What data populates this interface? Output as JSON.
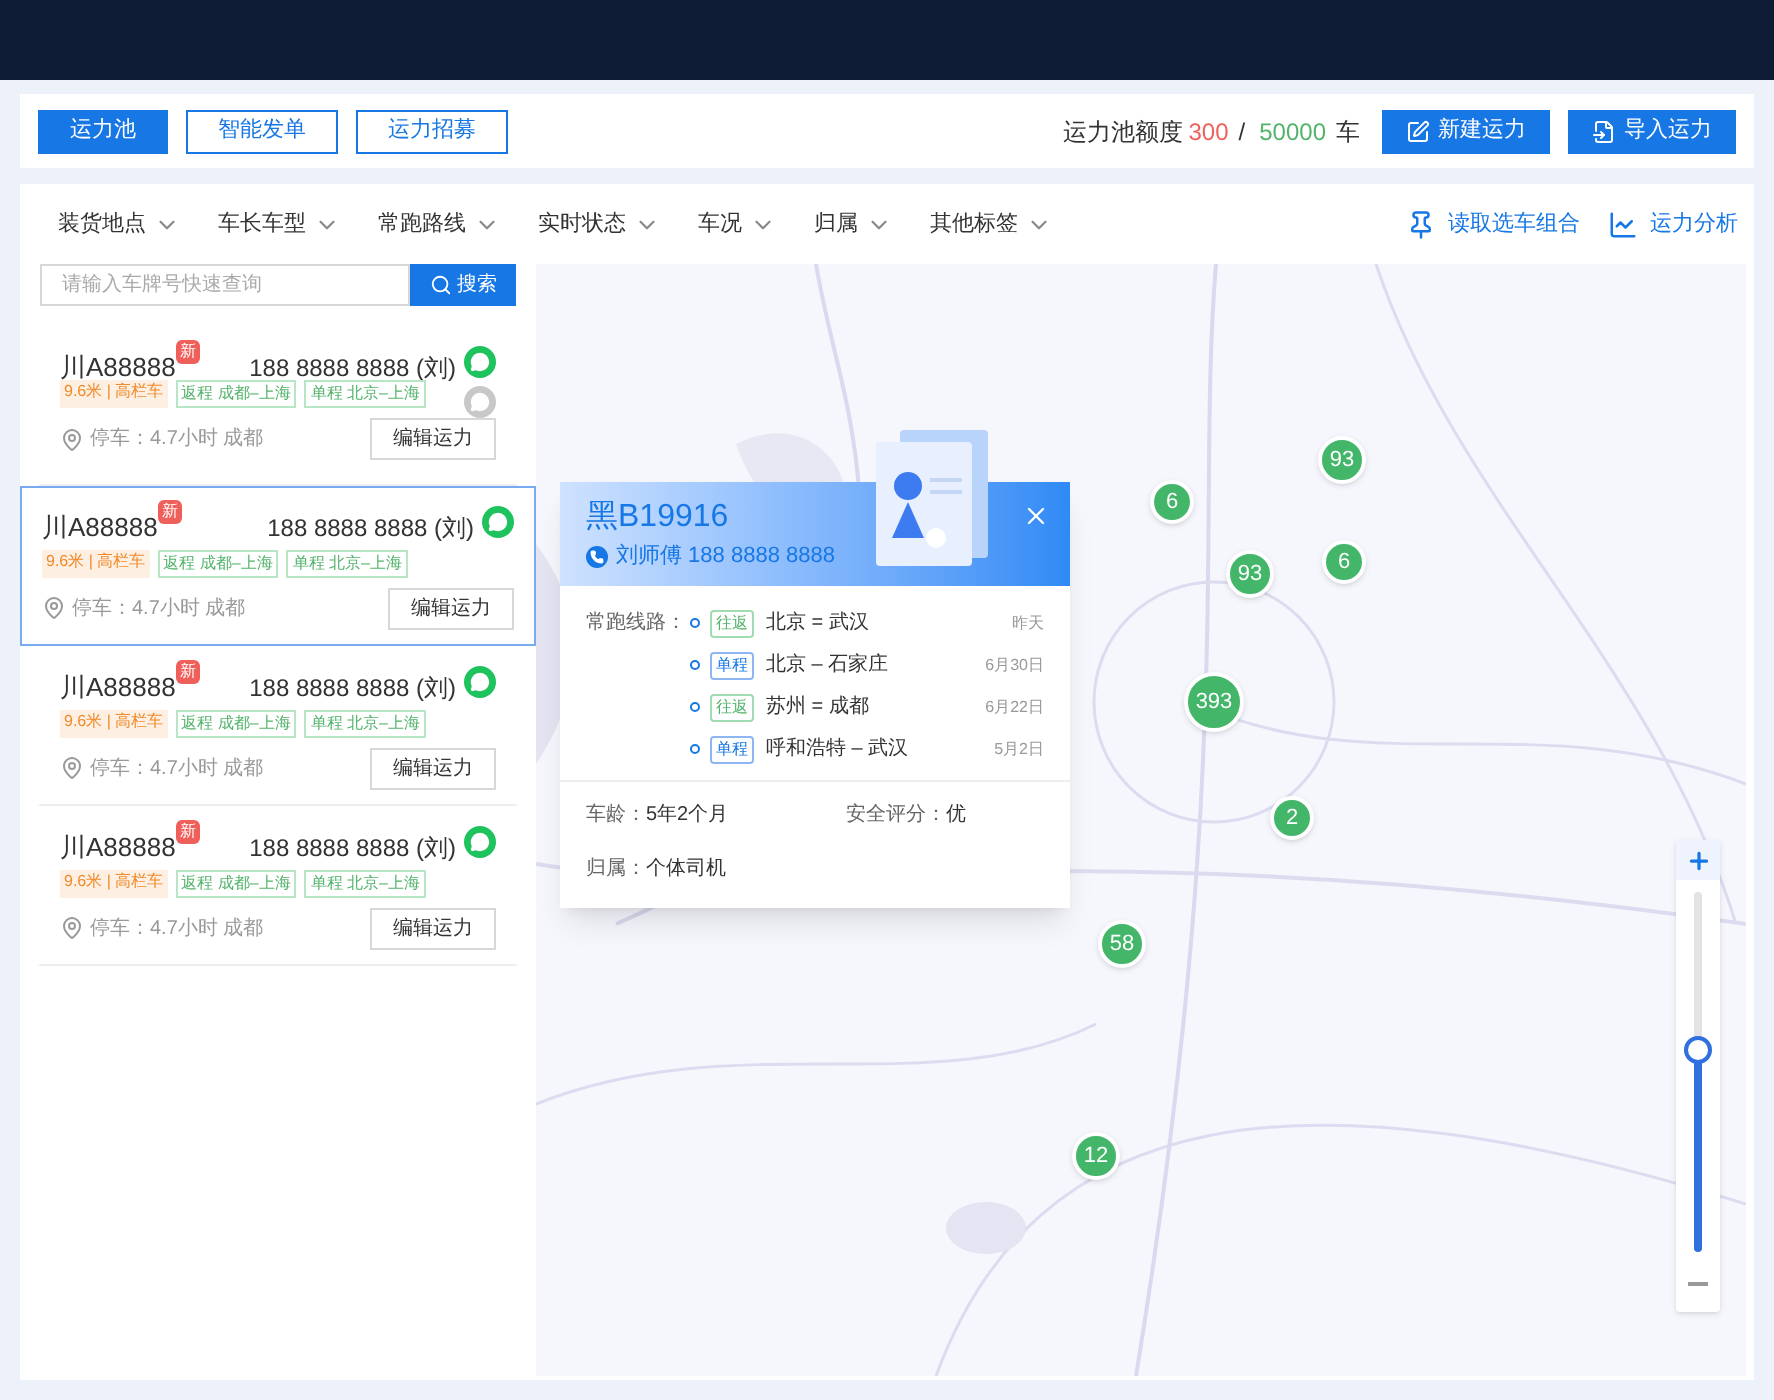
{
  "toolbar": {
    "tabs": [
      {
        "label": "运力池",
        "selected": true
      },
      {
        "label": "智能发单",
        "selected": false
      },
      {
        "label": "运力招募",
        "selected": false
      }
    ],
    "quota": {
      "label": "运力池额度",
      "used": "300",
      "separator": "/",
      "total": "50000",
      "unit": "车"
    },
    "actions": [
      "新建运力",
      "导入运力"
    ]
  },
  "filters": [
    "装货地点",
    "车长车型",
    "常跑路线",
    "实时状态",
    "车况",
    "归属",
    "其他标签"
  ],
  "links": [
    {
      "kind": "pin",
      "label": "读取选车组合"
    },
    {
      "kind": "chart",
      "label": "运力分析"
    }
  ],
  "search": {
    "placeholder": "请输入车牌号快速查询",
    "button": "搜索"
  },
  "vehicles": [
    {
      "plate": "川A88888",
      "badge": "新",
      "phone": "188 8888 8888 (刘)",
      "extra_contact": true,
      "selected": false,
      "tags": [
        {
          "kind": "spec",
          "text": "9.6米 | 高栏车"
        },
        {
          "kind": "route",
          "text": "返程 成都–上海"
        },
        {
          "kind": "route",
          "text": "单程 北京–上海"
        }
      ],
      "parking": "停车：4.7小时 成都",
      "button": "编辑运力"
    },
    {
      "plate": "川A88888",
      "badge": "新",
      "phone": "188 8888 8888 (刘)",
      "extra_contact": false,
      "selected": true,
      "tags": [
        {
          "kind": "spec",
          "text": "9.6米 | 高栏车"
        },
        {
          "kind": "route",
          "text": "返程 成都–上海"
        },
        {
          "kind": "route",
          "text": "单程 北京–上海"
        }
      ],
      "parking": "停车：4.7小时 成都",
      "button": "编辑运力"
    },
    {
      "plate": "川A88888",
      "badge": "新",
      "phone": "188 8888 8888 (刘)",
      "extra_contact": false,
      "selected": false,
      "tags": [
        {
          "kind": "spec",
          "text": "9.6米 | 高栏车"
        },
        {
          "kind": "route",
          "text": "返程 成都–上海"
        },
        {
          "kind": "route",
          "text": "单程 北京–上海"
        }
      ],
      "parking": "停车：4.7小时 成都",
      "button": "编辑运力"
    },
    {
      "plate": "川A88888",
      "badge": "新",
      "phone": "188 8888 8888 (刘)",
      "extra_contact": false,
      "selected": false,
      "tags": [
        {
          "kind": "spec",
          "text": "9.6米 | 高栏车"
        },
        {
          "kind": "route",
          "text": "返程 成都–上海"
        },
        {
          "kind": "route",
          "text": "单程 北京–上海"
        }
      ],
      "parking": "停车：4.7小时 成都",
      "button": "编辑运力"
    }
  ],
  "map": {
    "clusters": [
      "6",
      "93",
      "93",
      "6",
      "393",
      "2",
      "58",
      "12"
    ],
    "zoom": {
      "level": 0.56
    }
  },
  "popup": {
    "plate": "黑B19916",
    "driver": "刘师傅 188 8888 8888",
    "routes_label": "常跑线路：",
    "routes": [
      {
        "kind": "round",
        "tag": "往返",
        "route": "北京 = 武汉",
        "date": "昨天"
      },
      {
        "kind": "single",
        "tag": "单程",
        "route": "北京 – 石家庄",
        "date": "6月30日"
      },
      {
        "kind": "round",
        "tag": "往返",
        "route": "苏州 = 成都",
        "date": "6月22日"
      },
      {
        "kind": "single",
        "tag": "单程",
        "route": "呼和浩特 – 武汉",
        "date": "5月2日"
      }
    ],
    "age_label": "车龄：",
    "age": "5年2个月",
    "safety_label": "安全评分：",
    "safety": "优",
    "owner_label": "归属：",
    "owner": "个体司机"
  }
}
